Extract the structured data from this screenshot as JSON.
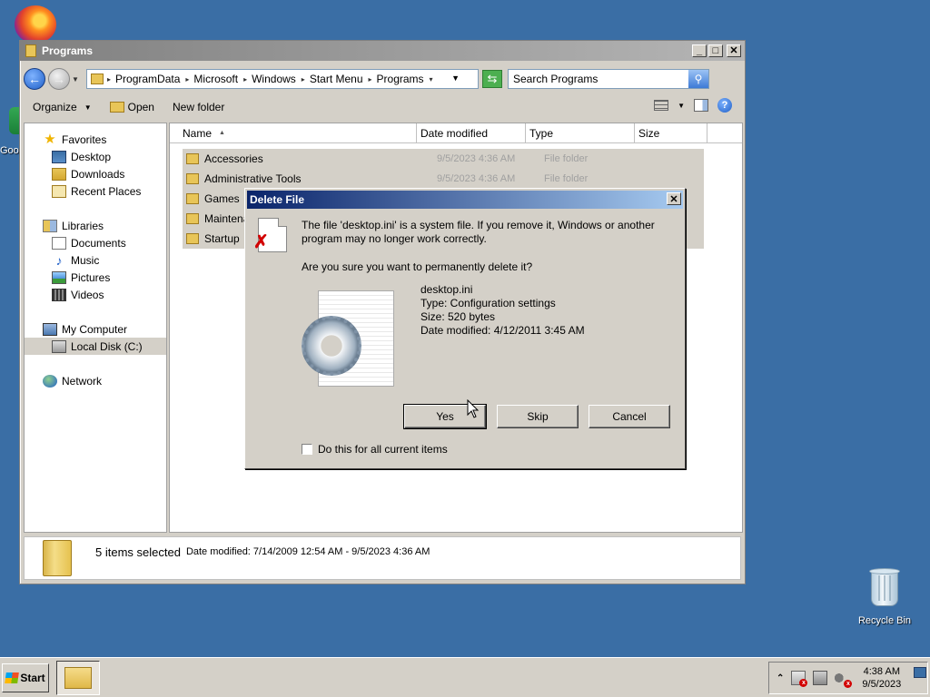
{
  "desktop": {
    "recycle_bin_label": "Recycle Bin",
    "partial_icon_label": "Goo"
  },
  "explorer": {
    "title": "Programs",
    "breadcrumbs": [
      "ProgramData",
      "Microsoft",
      "Windows",
      "Start Menu",
      "Programs"
    ],
    "search_placeholder": "Search Programs",
    "toolbar": {
      "organize": "Organize",
      "open": "Open",
      "new_folder": "New folder"
    },
    "nav": {
      "favorites": "Favorites",
      "favorites_items": [
        "Desktop",
        "Downloads",
        "Recent Places"
      ],
      "libraries": "Libraries",
      "library_items": [
        "Documents",
        "Music",
        "Pictures",
        "Videos"
      ],
      "computer": "My Computer",
      "computer_items": [
        "Local Disk (C:)"
      ],
      "network": "Network"
    },
    "columns": [
      "Name",
      "Date modified",
      "Type",
      "Size"
    ],
    "files": [
      {
        "name": "Accessories",
        "date": "9/5/2023 4:36 AM",
        "type": "File folder"
      },
      {
        "name": "Administrative Tools",
        "date": "9/5/2023 4:36 AM",
        "type": "File folder"
      },
      {
        "name": "Games",
        "date": "",
        "type": ""
      },
      {
        "name": "Maintenar",
        "date": "",
        "type": ""
      },
      {
        "name": "Startup",
        "date": "",
        "type": ""
      }
    ],
    "details": {
      "count": "5 items selected",
      "date_modified": "Date modified: 7/14/2009 12:54 AM - 9/5/2023 4:36 AM"
    }
  },
  "dialog": {
    "title": "Delete File",
    "message": "The file 'desktop.ini' is a system file. If you remove it, Windows or another program may no longer work correctly.",
    "question": "Are you sure you want to permanently delete it?",
    "file": {
      "name": "desktop.ini",
      "type": "Type: Configuration settings",
      "size": "Size: 520 bytes",
      "date": "Date modified: 4/12/2011 3:45 AM"
    },
    "buttons": {
      "yes": "Yes",
      "skip": "Skip",
      "cancel": "Cancel"
    },
    "checkbox_label": "Do this for all current items"
  },
  "taskbar": {
    "start_label": "Start",
    "time": "4:38 AM",
    "date": "9/5/2023"
  }
}
